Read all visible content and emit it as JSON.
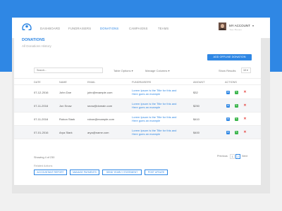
{
  "nav": {
    "items": [
      "DASHBOARD",
      "FUNDRAISERS",
      "DONATIONS",
      "CAMPAIGNS",
      "TEAMS"
    ],
    "active": "DONATIONS",
    "account_label": "MY ACCOUNT",
    "account_name": "Jon Snow"
  },
  "page": {
    "title": "DONATIONS",
    "subtitle": "All Donations History",
    "add_button": "ADD OFFLINE DONATION",
    "search_placeholder": "Search...",
    "table_options": "Table Options",
    "manage_columns": "Manage Columns",
    "show_results_label": "Show Results",
    "show_results_value": "10"
  },
  "table": {
    "headers": [
      "DATE",
      "NAME",
      "EMAIL",
      "FUNDRAISERS",
      "AMOUNT",
      "ACTIONS"
    ],
    "rows": [
      {
        "date": "07-12-2016",
        "name": "John Doe",
        "email": "john@example.com",
        "fundraiser": "Lorem Ipsum is the Title for this and Here goes an example",
        "amount": "$32"
      },
      {
        "date": "07-11-2016",
        "name": "Jon Snow",
        "email": "snow@domain.com",
        "fundraiser": "Lorem Ipsum is the Title for this and Here goes an example",
        "amount": "$250"
      },
      {
        "date": "07-11-2016",
        "name": "Robon Stark",
        "email": "robon@example.com",
        "fundraiser": "Lorem Ipsum is the Title for this and Here goes an example",
        "amount": "$410"
      },
      {
        "date": "07-01-2016",
        "name": "Arya Stark",
        "email": "arya@name.com",
        "fundraiser": "Lorem Ipsum is the Title for this and Here goes an example",
        "amount": "$400"
      }
    ]
  },
  "footer": {
    "showing": "Showing 4 of 230",
    "prev": "Previous",
    "pages": [
      "1",
      "2"
    ],
    "current_page": "2",
    "next": "Next",
    "related_label": "Related Actions",
    "related_buttons": [
      "ACCOUNTANT REPORT",
      "MANAGE PAYMENTS",
      "SEND YEARLY STATEMENT",
      "POST UPDATE"
    ]
  },
  "colors": {
    "accent": "#2f87e4",
    "edit": "#39b54a",
    "delete": "#e53935"
  },
  "icons": {
    "logo": "people-network-logo",
    "mail": "mail-icon",
    "edit": "edit-icon",
    "delete": "delete-icon",
    "caret": "chevron-down-icon"
  }
}
